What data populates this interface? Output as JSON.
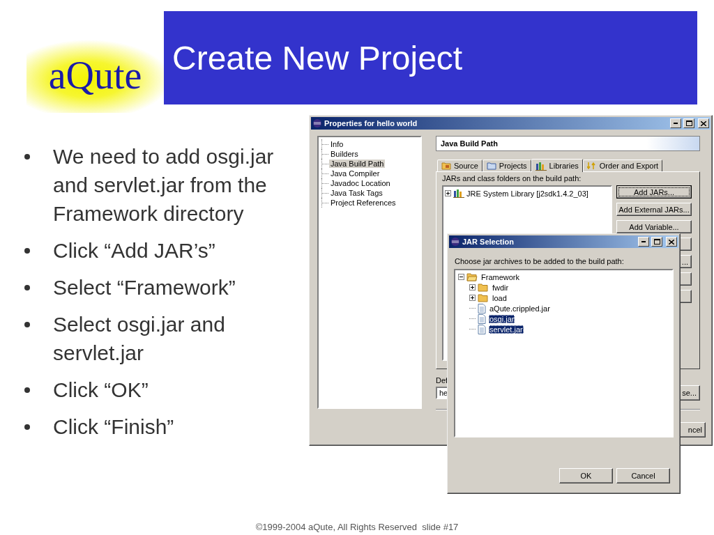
{
  "logo": {
    "text": "aQute"
  },
  "title": "Create New Project",
  "bullets": [
    "We need to add osgi.jar and servlet.jar from the Framework directory",
    "Click “Add JAR’s”",
    "Select “Framework”",
    "Select osgi.jar and servlet.jar",
    "Click “OK”",
    "Click “Finish”"
  ],
  "properties_window": {
    "title": "Properties for hello world",
    "nav": [
      {
        "label": "Info",
        "selected": false
      },
      {
        "label": "Builders",
        "selected": false
      },
      {
        "label": "Java Build Path",
        "selected": true
      },
      {
        "label": "Java Compiler",
        "selected": false
      },
      {
        "label": "Javadoc Location",
        "selected": false
      },
      {
        "label": "Java Task Tags",
        "selected": false
      },
      {
        "label": "Project References",
        "selected": false
      }
    ],
    "page_title": "Java Build Path",
    "tabs": [
      {
        "label": "Source",
        "kind": "source",
        "selected": false
      },
      {
        "label": "Projects",
        "kind": "projects",
        "selected": false
      },
      {
        "label": "Libraries",
        "kind": "libraries",
        "selected": true
      },
      {
        "label": "Order and Export",
        "kind": "order",
        "selected": false
      }
    ],
    "libraries_label": "JARs and class folders on the build path:",
    "libraries": [
      {
        "label": "JRE System Library [j2sdk1.4.2_03]",
        "expanded": false
      }
    ],
    "side_buttons": [
      {
        "label": "Add JARs...",
        "kind": "full",
        "focused": true
      },
      {
        "label": "Add External JARs...",
        "kind": "full",
        "focused": false
      },
      {
        "label": "Add Variable...",
        "kind": "full",
        "focused": false
      },
      {
        "kind": "covered",
        "focused": false
      },
      {
        "label": "...",
        "kind": "covered",
        "focused": false
      },
      {
        "kind": "covered",
        "focused": false
      },
      {
        "kind": "covered",
        "focused": false
      }
    ],
    "output_label": "Def",
    "output_field": "he",
    "browse_button": "se...",
    "bottom_buttons": [
      "ncel"
    ]
  },
  "jar_window": {
    "title": "JAR Selection",
    "prompt": "Choose jar archives to be added to the build path:",
    "tree": [
      {
        "label": "Framework",
        "kind": "folder",
        "expanded": true,
        "selected": false,
        "children": [
          {
            "label": "fwdir",
            "kind": "folder",
            "expanded": false,
            "selected": false
          },
          {
            "label": "load",
            "kind": "folder",
            "expanded": false,
            "selected": false
          },
          {
            "label": "aQute.crippled.jar",
            "kind": "file",
            "selected": false
          },
          {
            "label": "osgi.jar",
            "kind": "file",
            "selected": true
          },
          {
            "label": "servlet.jar",
            "kind": "file",
            "selected": true
          }
        ]
      }
    ],
    "buttons": [
      "OK",
      "Cancel"
    ]
  },
  "footer": "©1999-2004 aQute, All Rights Reserved  slide #17"
}
